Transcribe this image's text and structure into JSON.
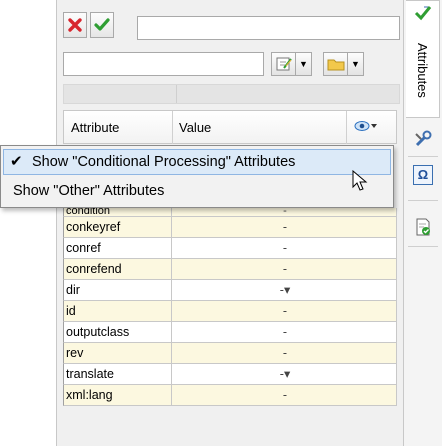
{
  "toolbar": {
    "cancel_icon": "red-x-icon",
    "accept_icon": "green-check-icon",
    "name_value": "",
    "filter_value": ""
  },
  "table": {
    "col_attribute": "Attribute",
    "col_value": "Value",
    "rows": [
      {
        "name": "condition",
        "value": "-",
        "style": "yellow"
      },
      {
        "name": "conkeyref",
        "value": "-",
        "style": "yellow"
      },
      {
        "name": "conref",
        "value": "-",
        "style": "white"
      },
      {
        "name": "conrefend",
        "value": "-",
        "style": "yellow"
      },
      {
        "name": "dir",
        "value": "-▾",
        "style": "white"
      },
      {
        "name": "id",
        "value": "-",
        "style": "yellow"
      },
      {
        "name": "outputclass",
        "value": "-",
        "style": "white"
      },
      {
        "name": "rev",
        "value": "-",
        "style": "yellow"
      },
      {
        "name": "translate",
        "value": "-▾",
        "style": "white"
      },
      {
        "name": "xml:lang",
        "value": "-",
        "style": "yellow"
      }
    ]
  },
  "menu": {
    "items": [
      {
        "label": "Show \"Conditional Processing\" Attributes",
        "checked": true
      },
      {
        "label": "Show \"Other\" Attributes",
        "checked": false
      }
    ]
  },
  "sidebar": {
    "attributes_tab": "Attributes"
  },
  "colors": {
    "row_yellow": "#fcf8e0",
    "menu_highlight": "#dceaf8",
    "cancel_red": "#d8262e",
    "accept_green": "#2f9e33"
  }
}
